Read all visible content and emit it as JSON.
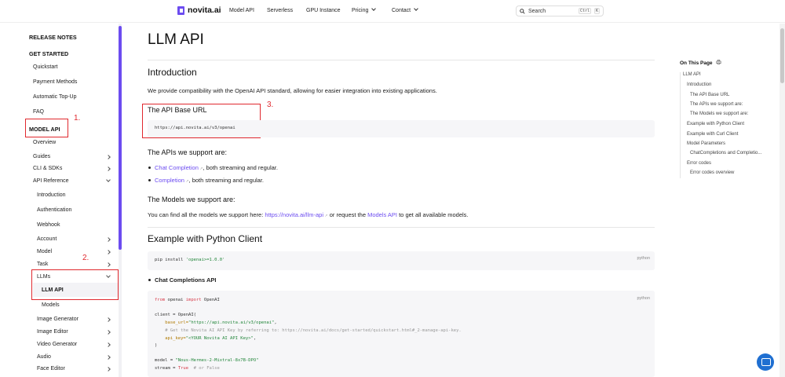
{
  "topnav": {
    "logo": "novita.ai",
    "items": [
      "Model API",
      "Serverless",
      "GPU Instance",
      "Pricing",
      "Contact"
    ],
    "search_placeholder": "Search",
    "kbd_ctrl": "Ctrl",
    "kbd_k": "K"
  },
  "sidebar": {
    "release_notes": "RELEASE NOTES",
    "get_started": "GET STARTED",
    "quickstart": "Quickstart",
    "payment_methods": "Payment Methods",
    "automatic_topup": "Automatic Top-Up",
    "faq": "FAQ",
    "model_api": "MODEL API",
    "overview": "Overview",
    "guides": "Guides",
    "cli_sdks": "CLI & SDKs",
    "api_reference": "API Reference",
    "introduction": "Introduction",
    "authentication": "Authentication",
    "webhook": "Webhook",
    "account": "Account",
    "model": "Model",
    "task": "Task",
    "llms": "LLMs",
    "llm_api": "LLM API",
    "models": "Models",
    "image_generator": "Image Generator",
    "image_editor": "Image Editor",
    "video_generator": "Video Generator",
    "audio": "Audio",
    "face_editor": "Face Editor"
  },
  "annotations": {
    "a1": "1.",
    "a2": "2.",
    "a3": "3."
  },
  "main": {
    "title": "LLM API",
    "intro_heading": "Introduction",
    "intro_text": "We provide compatibility with the OpenAI API standard, allowing for easier integration into existing applications.",
    "base_url_heading": "The API Base URL",
    "base_url": "https://api.novita.ai/v3/openai",
    "apis_heading": "The APIs we support are:",
    "api1_link": "Chat Completion",
    "api1_rest": ", both streaming and regular.",
    "api2_link": "Completion",
    "api2_rest": ", both streaming and regular.",
    "models_heading": "The Models we support are:",
    "models_text_1": "You can find all the models we support here: ",
    "models_link_1": "https://novita.ai/llm-api",
    "models_text_2": " or request the ",
    "models_link_2": "Models API",
    "models_text_3": " to get all available models.",
    "python_heading": "Example with Python Client",
    "pip_cmd_1": "pip install ",
    "pip_cmd_2": "'openai>=1.0.0'",
    "lang_label": "python",
    "chat_completions_api": "Chat Completions API",
    "code": {
      "l1a": "from",
      "l1b": " openai ",
      "l1c": "import",
      "l1d": " OpenAI",
      "l2": "client = OpenAI(",
      "l3a": "    base_url=",
      "l3b": "\"https://api.novita.ai/v3/openai\"",
      "l3c": ",",
      "l4": "    # Get the Novita AI API Key by referring to: https://novita.ai/docs/get-started/quickstart.html#_2-manage-api-key.",
      "l5a": "    api_key=",
      "l5b": "\"<YOUR Novita AI API Key>\"",
      "l5c": ",",
      "l6": ")",
      "l7a": "model = ",
      "l7b": "\"Nous-Hermes-2-Mixtral-8x7B-DPO\"",
      "l8a": "stream = ",
      "l8b": "True",
      "l8c": "  # or False"
    }
  },
  "toc": {
    "title": "On This Page",
    "items": [
      "LLM API",
      "Introduction",
      "The API Base URL",
      "The APIs we support are:",
      "The Models we support are:",
      "Example with Python Client",
      "Example with Curl Client",
      "Model Parameters",
      "ChatCompletions and Completio...",
      "Error codes",
      "Error codes overview"
    ]
  },
  "colors": {
    "accent": "#6c4cf0",
    "annotation": "#e0282e"
  }
}
